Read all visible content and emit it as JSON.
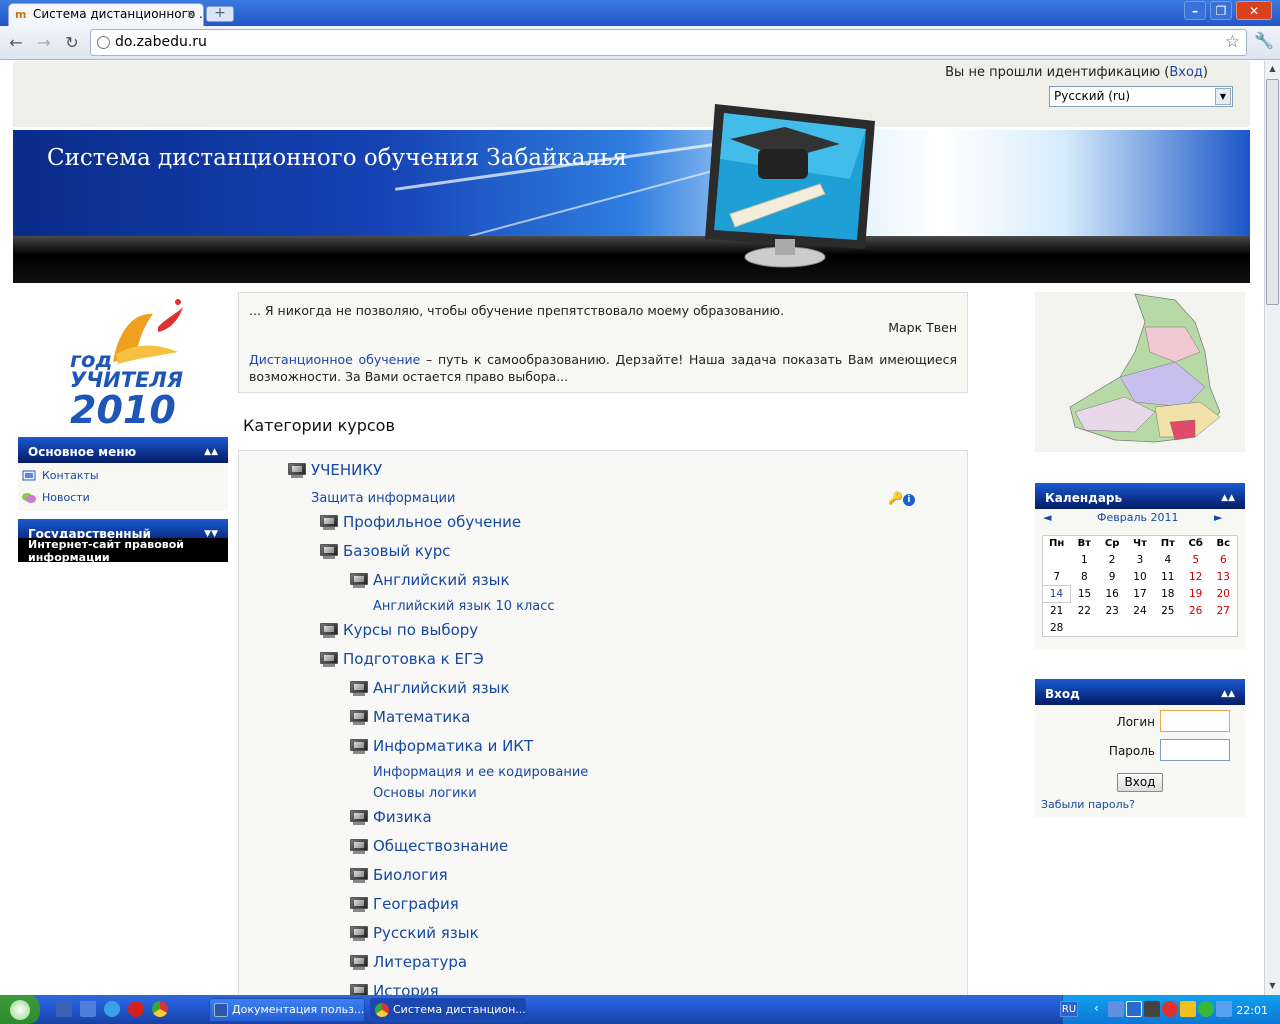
{
  "browser": {
    "tab_title": "Система дистанционного ...",
    "url": "do.zabedu.ru",
    "new_tab": "+",
    "close_tab": "×"
  },
  "header": {
    "login_prefix": "Вы не прошли идентификацию (",
    "login_link": "Вход",
    "login_suffix": ")",
    "language": "Русский (ru)",
    "site_title": "Система дистанционного обучения Забайкалья"
  },
  "left": {
    "logo": {
      "line1": "год",
      "line2": "УЧИТЕЛЯ",
      "line3": "2010"
    },
    "main_menu": {
      "title": "Основное меню",
      "items": [
        {
          "label": "Контакты",
          "icon": "contacts-icon"
        },
        {
          "label": "Новости",
          "icon": "news-icon"
        }
      ]
    },
    "gov_block": {
      "title": "Государственный",
      "body": "Интернет-сайт правовой информации"
    }
  },
  "center": {
    "quote_text": "... Я никогда не позволяю, чтобы обучение препятствовало моему образованию.",
    "quote_author": "Марк Твен",
    "intro_link": "Дистанционное обучение",
    "intro_text": " – путь к самообразованию. Дерзайте! Наша задача показать Вам имеющиеся возможности. За Вами остается право выбора...",
    "categories_title": "Категории курсов",
    "categories": [
      {
        "label": "УЧЕНИКУ",
        "level": 0
      },
      {
        "label": "Профильное обучение",
        "level": 1
      },
      {
        "label": "Базовый курс",
        "level": 1
      },
      {
        "label": "Английский язык",
        "level": 2
      },
      {
        "label": "Курсы по выбору",
        "level": 1
      },
      {
        "label": "Подготовка к ЕГЭ",
        "level": 1
      },
      {
        "label": "Английский язык",
        "level": 2
      },
      {
        "label": "Математика",
        "level": 2
      },
      {
        "label": "Информатика и ИКТ",
        "level": 2
      },
      {
        "label": "Физика",
        "level": 2
      },
      {
        "label": "Обществознание",
        "level": 2
      },
      {
        "label": "Биология",
        "level": 2
      },
      {
        "label": "География",
        "level": 2
      },
      {
        "label": "Русский язык",
        "level": 2
      },
      {
        "label": "Литература",
        "level": 2
      },
      {
        "label": "История",
        "level": 2
      }
    ],
    "courses": [
      "Защита информации",
      "Английский язык 10 класс",
      "Информация и ее кодирование",
      "Основы логики"
    ]
  },
  "right": {
    "calendar": {
      "title": "Календарь",
      "prev": "◄",
      "next": "►",
      "month": "Февраль 2011",
      "weekdays": [
        "Пн",
        "Вт",
        "Ср",
        "Чт",
        "Пт",
        "Сб",
        "Вс"
      ],
      "weeks": [
        [
          "",
          "1",
          "2",
          "3",
          "4",
          "5",
          "6"
        ],
        [
          "7",
          "8",
          "9",
          "10",
          "11",
          "12",
          "13"
        ],
        [
          "14",
          "15",
          "16",
          "17",
          "18",
          "19",
          "20"
        ],
        [
          "21",
          "22",
          "23",
          "24",
          "25",
          "26",
          "27"
        ],
        [
          "28",
          "",
          "",
          "",
          "",
          "",
          ""
        ]
      ],
      "today": "14"
    },
    "login": {
      "title": "Вход",
      "username_label": "Логин",
      "password_label": "Пароль",
      "button": "Вход",
      "forgot": "Забыли пароль?"
    }
  },
  "taskbar": {
    "items": [
      "Документация польз...",
      "Система дистанцион..."
    ],
    "language": "RU",
    "clock": "22:01"
  },
  "colors": {
    "link": "#1848a0",
    "block_header": "#0a2c86",
    "weekend": "#cc0000"
  }
}
